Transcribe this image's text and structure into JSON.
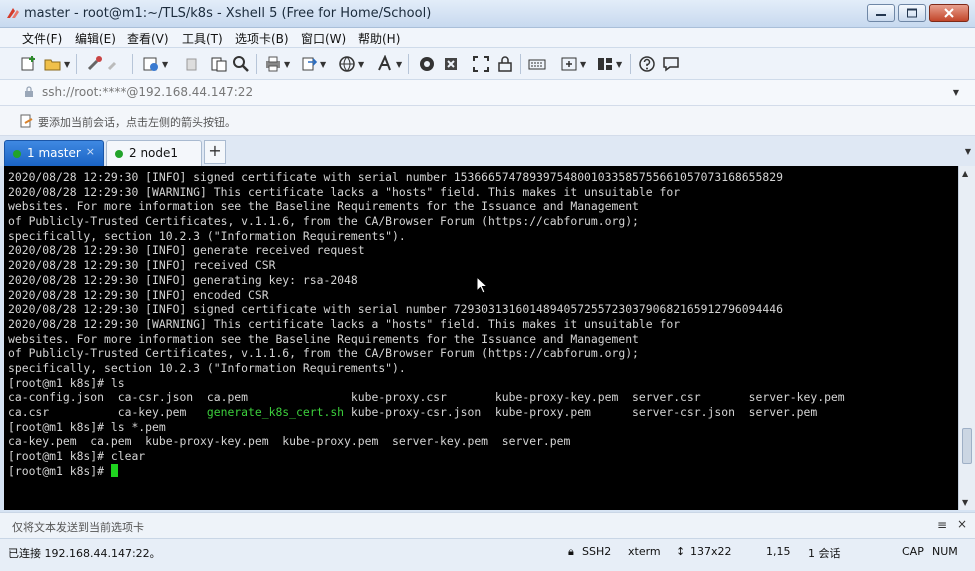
{
  "window": {
    "title": "master - root@m1:~/TLS/k8s - Xshell 5 (Free for Home/School)"
  },
  "menu": {
    "items": [
      "文件(F)",
      "编辑(E)",
      "查看(V)",
      "工具(T)",
      "选项卡(B)",
      "窗口(W)",
      "帮助(H)"
    ]
  },
  "address": {
    "value": "ssh://root:****@192.168.44.147:22"
  },
  "hint": {
    "text": "要添加当前会话，点击左侧的箭头按钮。"
  },
  "tabs": [
    {
      "label": "1 master",
      "active": true
    },
    {
      "label": "2 node1",
      "active": false
    }
  ],
  "terminal": {
    "lines": [
      [
        {
          "t": "2020/08/28 12:29:30 [INFO] signed certificate with serial number 153666574789397548001033585755661057073168655829"
        }
      ],
      [
        {
          "t": "2020/08/28 12:29:30 [WARNING] This certificate lacks a \"hosts\" field. This makes it unsuitable for"
        }
      ],
      [
        {
          "t": "websites. For more information see the Baseline Requirements for the Issuance and Management"
        }
      ],
      [
        {
          "t": "of Publicly-Trusted Certificates, v.1.1.6, from the CA/Browser Forum (https://cabforum.org);"
        }
      ],
      [
        {
          "t": "specifically, section 10.2.3 (\"Information Requirements\")."
        }
      ],
      [
        {
          "t": "2020/08/28 12:29:30 [INFO] generate received request"
        }
      ],
      [
        {
          "t": "2020/08/28 12:29:30 [INFO] received CSR"
        }
      ],
      [
        {
          "t": "2020/08/28 12:29:30 [INFO] generating key: rsa-2048"
        }
      ],
      [
        {
          "t": "2020/08/28 12:29:30 [INFO] encoded CSR"
        }
      ],
      [
        {
          "t": "2020/08/28 12:29:30 [INFO] signed certificate with serial number 729303131601489405725572303790682165912796094446"
        }
      ],
      [
        {
          "t": "2020/08/28 12:29:30 [WARNING] This certificate lacks a \"hosts\" field. This makes it unsuitable for"
        }
      ],
      [
        {
          "t": "websites. For more information see the Baseline Requirements for the Issuance and Management"
        }
      ],
      [
        {
          "t": "of Publicly-Trusted Certificates, v.1.1.6, from the CA/Browser Forum (https://cabforum.org);"
        }
      ],
      [
        {
          "t": "specifically, section 10.2.3 (\"Information Requirements\")."
        }
      ],
      [
        {
          "t": "[root@m1 k8s]# ls"
        }
      ],
      [
        {
          "t": "ca-config.json  ca-csr.json  ca.pem               kube-proxy.csr       kube-proxy-key.pem  server.csr       server-key.pem"
        }
      ],
      [
        {
          "t": "ca.csr          ca-key.pem   "
        },
        {
          "t": "generate_k8s_cert.sh",
          "c": "green"
        },
        {
          "t": " kube-proxy-csr.json  kube-proxy.pem      server-csr.json  server.pem"
        }
      ],
      [
        {
          "t": "[root@m1 k8s]# ls *.pem"
        }
      ],
      [
        {
          "t": "ca-key.pem  ca.pem  kube-proxy-key.pem  kube-proxy.pem  server-key.pem  server.pem"
        }
      ],
      [
        {
          "t": "[root@m1 k8s]# clear"
        }
      ],
      [
        {
          "t": "[root@m1 k8s]# "
        }
      ]
    ]
  },
  "sendbar": {
    "text": "仅将文本发送到当前选项卡"
  },
  "status": {
    "connection": "已连接 192.168.44.147:22。",
    "protocol": "SSH2",
    "terminal_type": "xterm",
    "size": "137x22",
    "cursor_pos": "1,15",
    "sessions": "1 会话",
    "caps": "CAP",
    "num": "NUM"
  }
}
